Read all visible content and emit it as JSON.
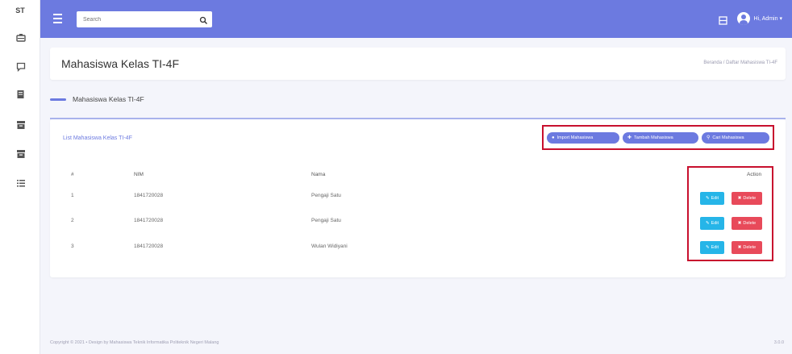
{
  "sidebar": {
    "brand": "ST",
    "icons": [
      "dashboard-icon",
      "chat-icon",
      "book-icon",
      "archive-icon",
      "list-icon"
    ]
  },
  "topbar": {
    "search": {
      "placeholder": "Search"
    },
    "user": {
      "name": "Hi, Admin",
      "caret": "▾"
    },
    "bg_color": "#6c7ae0"
  },
  "header": {
    "title": "Mahasiswa Kelas TI-4F",
    "breadcrumb": "Beranda / Daftar Mahasiswa TI-4F"
  },
  "section": {
    "title": "Mahasiswa Kelas TI-4F"
  },
  "card": {
    "title": "List Mahasiswa Kelas TI-4F",
    "buttons": {
      "import": "Import Mahasiswa",
      "add": "Tambah Mahasiswa",
      "search": "Cari Mahasiswa"
    },
    "table": {
      "headers": {
        "no": "#",
        "nim": "NIM",
        "name": "Nama",
        "action": "Action"
      },
      "rows": [
        {
          "no": "1",
          "nim": "1841720028",
          "name": "Pengaji Satu"
        },
        {
          "no": "2",
          "nim": "1841720028",
          "name": "Pengaji Satu"
        },
        {
          "no": "3",
          "nim": "1841720028",
          "name": "Wulan Widiyani"
        }
      ],
      "edit_label": "Edit",
      "delete_label": "Delete"
    }
  },
  "footer": {
    "copyright": "Copyright © 2021 • Design by Mahasiswa Teknik Informatika Politeknik Negeri Malang",
    "version": "3.0.0"
  },
  "colors": {
    "accent": "#6c7ae0",
    "edit": "#26b5e8",
    "delete": "#e84a5a",
    "highlight_box": "#c8102e"
  }
}
